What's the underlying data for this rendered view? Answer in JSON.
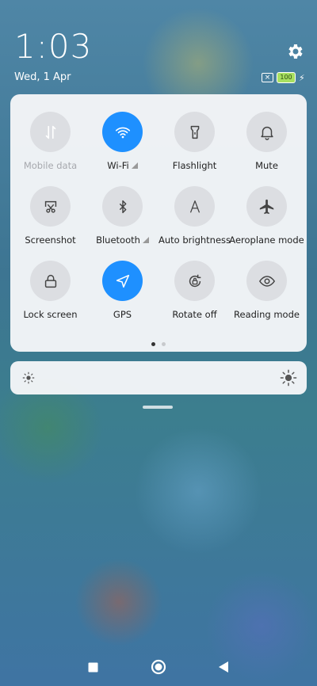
{
  "status": {
    "time": "1:03",
    "date": "Wed, 1 Apr",
    "battery_level": "100",
    "sim_icon": "x-sim-icon",
    "charging_icon": "bolt-icon"
  },
  "colors": {
    "accent": "#1e90ff",
    "tile_off": "#dcdee2",
    "panel": "#f5f6f8"
  },
  "tiles": [
    {
      "label": "Mobile data",
      "icon": "mobile-data-icon",
      "active": false,
      "disabled": true
    },
    {
      "label": "Wi-Fi",
      "icon": "wifi-icon",
      "active": true,
      "signal": true
    },
    {
      "label": "Flashlight",
      "icon": "flashlight-icon",
      "active": false
    },
    {
      "label": "Mute",
      "icon": "bell-icon",
      "active": false
    },
    {
      "label": "Screenshot",
      "icon": "screenshot-icon",
      "active": false
    },
    {
      "label": "Bluetooth",
      "icon": "bluetooth-icon",
      "active": false,
      "signal": true
    },
    {
      "label": "Auto brightness",
      "icon": "auto-brightness-icon",
      "active": false
    },
    {
      "label": "Aeroplane mode",
      "icon": "airplane-icon",
      "active": false
    },
    {
      "label": "Lock screen",
      "icon": "lock-icon",
      "active": false
    },
    {
      "label": "GPS",
      "icon": "location-arrow-icon",
      "active": true
    },
    {
      "label": "Rotate off",
      "icon": "rotate-lock-icon",
      "active": false
    },
    {
      "label": "Reading mode",
      "icon": "eye-icon",
      "active": false
    }
  ],
  "pagination": {
    "pages": 2,
    "current": 1
  },
  "brightness": {
    "min_icon": "sun-small-icon",
    "max_icon": "sun-large-icon"
  },
  "navigation": {
    "recents": "square-icon",
    "home": "circle-icon",
    "back": "triangle-icon"
  }
}
